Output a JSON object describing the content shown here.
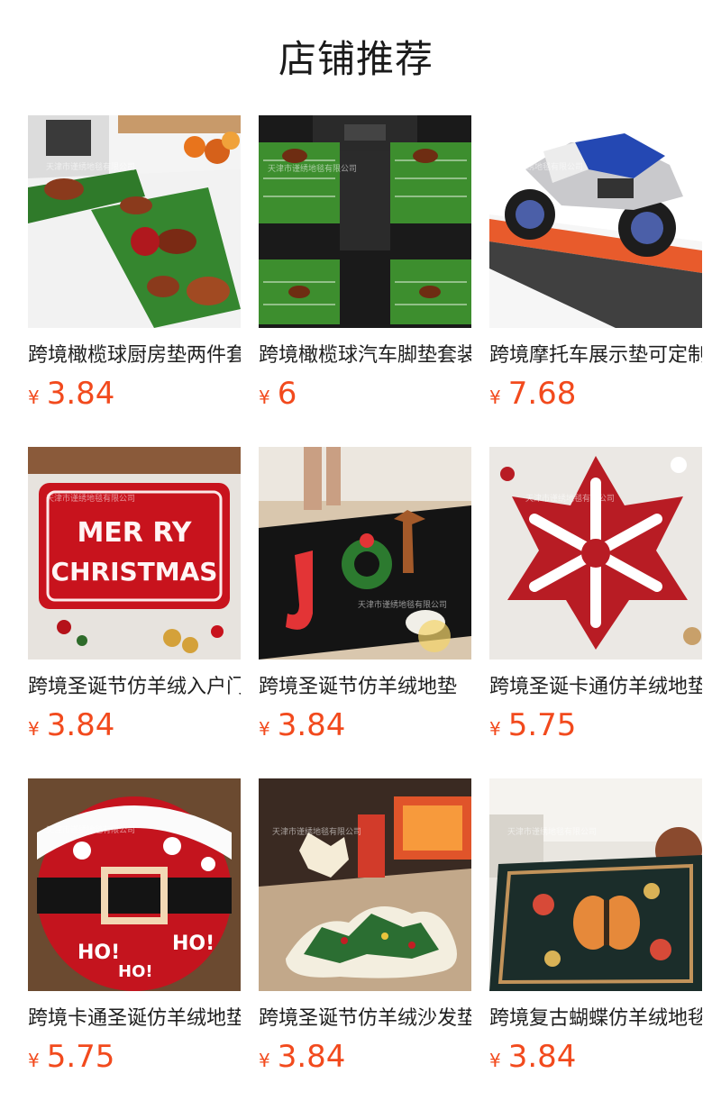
{
  "page": {
    "title": "店铺推荐"
  },
  "currency_symbol": "¥",
  "watermark": "天津市谨绣地毯有限公司",
  "products": [
    {
      "title": "跨境橄榄球厨房垫两件套",
      "price": "3.84",
      "image": "football-kitchen-mats-image"
    },
    {
      "title": "跨境橄榄球汽车脚垫套装",
      "price": "6",
      "image": "football-car-floor-mats-image"
    },
    {
      "title": "跨境摩托车展示垫可定制",
      "price": "7.68",
      "image": "motorcycle-display-mat-image"
    },
    {
      "title": "跨境圣诞节仿羊绒入户门垫",
      "price": "3.84",
      "image": "merry-christmas-rug-image"
    },
    {
      "title": "跨境圣诞节仿羊绒地垫",
      "price": "3.84",
      "image": "joy-christmas-rug-image"
    },
    {
      "title": "跨境圣诞卡通仿羊绒地垫",
      "price": "5.75",
      "image": "snowflake-rug-image"
    },
    {
      "title": "跨境卡通圣诞仿羊绒地垫",
      "price": "5.75",
      "image": "santa-belt-round-rug-image"
    },
    {
      "title": "跨境圣诞节仿羊绒沙发垫",
      "price": "3.84",
      "image": "christmas-tree-rug-image"
    },
    {
      "title": "跨境复古蝴蝶仿羊绒地毯",
      "price": "3.84",
      "image": "vintage-butterfly-carpet-image"
    }
  ]
}
